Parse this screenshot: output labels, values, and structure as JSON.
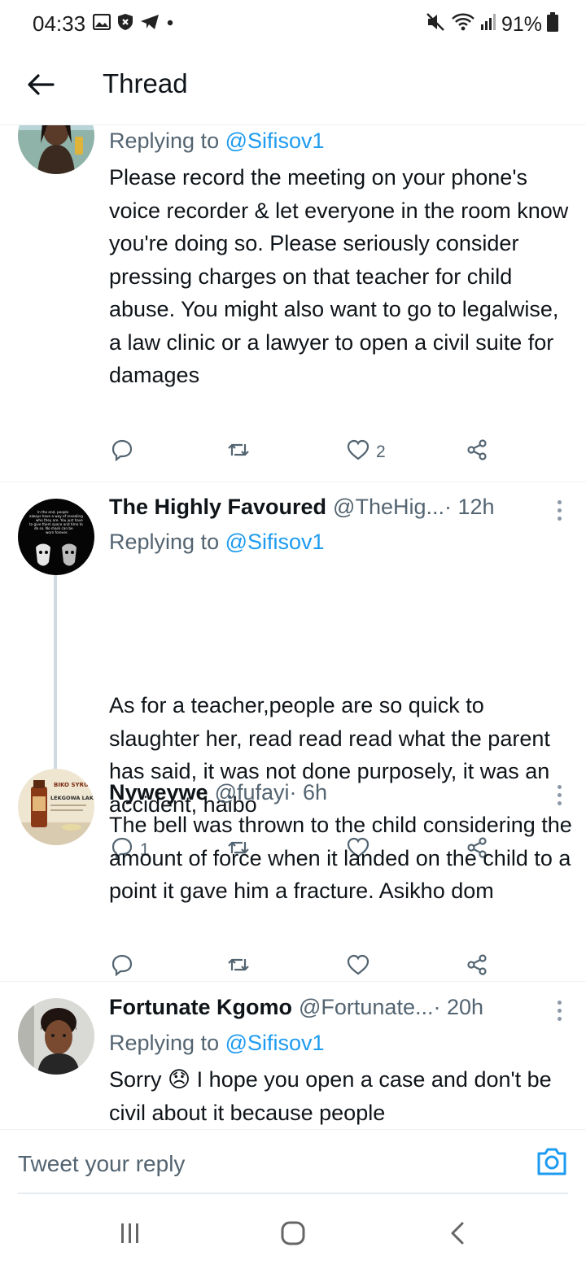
{
  "status_bar": {
    "time": "04:33",
    "battery": "91%",
    "icons": [
      "gallery-icon",
      "shield-icon",
      "telegram-icon",
      "dot-icon",
      "mute-icon",
      "wifi-icon",
      "signal-icon",
      "battery-icon"
    ]
  },
  "header": {
    "title": "Thread",
    "back_icon": "arrow-left-icon"
  },
  "tweets": [
    {
      "reply_prefix": "Replying to ",
      "reply_to": "@Sifisov1",
      "text": "Please record the meeting on your phone's voice recorder & let everyone in the room know you're doing so. Please seriously consider pressing charges on that teacher for child abuse. You might also want to go to legalwise, a law clinic or a lawyer to open a civil suite for damages",
      "likes": "2"
    },
    {
      "name": "The Highly Favoured",
      "handle": "@TheHig...",
      "time": " · 12h",
      "reply_prefix": "Replying to ",
      "reply_to": "@Sifisov1",
      "text": "As for a teacher,people are so quick to slaughter her, read read read what the parent has said, it was not done purposely, it was an accident, haibo",
      "replies": "1",
      "avatar_quote": "In the end, people always have a way of revealing who they are. You just have to give them space and time to do so. No mask can be worn forever."
    },
    {
      "name": "Nyweywe",
      "handle": "@fufayi",
      "time": " · 6h",
      "text": "The bell was thrown to the child considering the amount of force when it landed on the child to a point it gave him a fracture. Asikho dom",
      "avatar_label_1": "BIKO SYRUP",
      "avatar_label_2": "LEKGOWA LAKA"
    },
    {
      "name": "Fortunate Kgomo",
      "handle": "@Fortunate...",
      "time": " · 20h",
      "reply_prefix": "Replying to ",
      "reply_to": "@Sifisov1",
      "text_before_emoji": "Sorry ",
      "emoji": "😞",
      "text_after_emoji": " I hope you open a case and don't be civil about it because people"
    }
  ],
  "reply_bar": {
    "placeholder": "Tweet your reply",
    "camera_icon": "camera-icon"
  },
  "nav": {
    "recents": "recents-icon",
    "home": "home-icon",
    "back": "back-icon"
  },
  "colors": {
    "link": "#1d9bf0",
    "secondary_text": "#536471",
    "primary_text": "#0f1419",
    "divider": "#eff3f4"
  }
}
